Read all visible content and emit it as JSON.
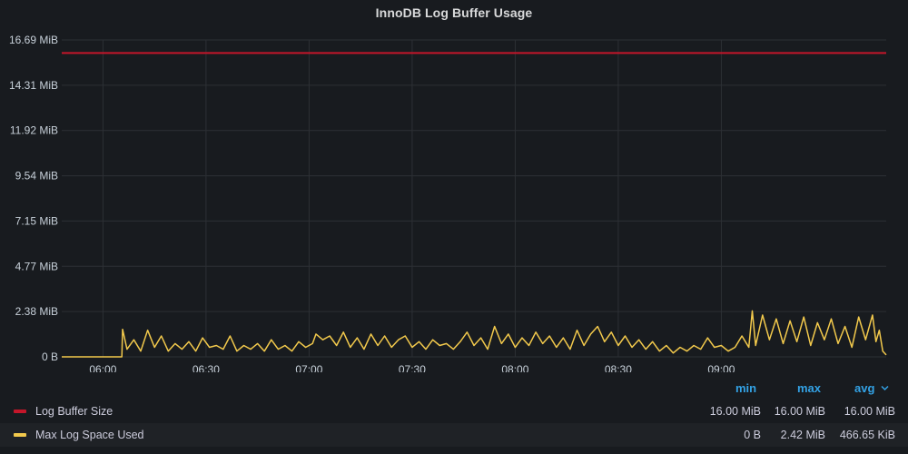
{
  "panel": {
    "title": "InnoDB Log Buffer Usage"
  },
  "colors": {
    "background": "#181b1f",
    "grid": "#2c3035",
    "series1": "#c4162a",
    "series2": "#f2c94c",
    "legend_header": "#33a2e5"
  },
  "legend": {
    "headers": {
      "min": "min",
      "max": "max",
      "avg": "avg"
    },
    "sort_icon": "chevron-down-icon",
    "rows": [
      {
        "name": "Log Buffer Size",
        "color": "#c4162a",
        "min": "16.00 MiB",
        "max": "16.00 MiB",
        "avg": "16.00 MiB"
      },
      {
        "name": "Max Log Space Used",
        "color": "#f2c94c",
        "min": "0 B",
        "max": "2.42 MiB",
        "avg": "466.65 KiB"
      }
    ]
  },
  "chart_data": {
    "type": "line",
    "title": "InnoDB Log Buffer Usage",
    "x_range": [
      "05:48",
      "09:48"
    ],
    "x_tick_labels": [
      "06:00",
      "06:30",
      "07:00",
      "07:30",
      "08:00",
      "08:30",
      "09:00"
    ],
    "y_tick_labels": [
      "0 B",
      "2.38 MiB",
      "4.77 MiB",
      "7.15 MiB",
      "9.54 MiB",
      "11.92 MiB",
      "14.31 MiB",
      "16.69 MiB"
    ],
    "y_unit": "MiB",
    "ylim": [
      0,
      16.69
    ],
    "grid": true,
    "series": [
      {
        "name": "Log Buffer Size",
        "values": [
          [
            0,
            16.0
          ],
          [
            240,
            16.0
          ]
        ]
      },
      {
        "name": "Max Log Space Used",
        "values": [
          [
            0,
            0
          ],
          [
            17.5,
            0
          ],
          [
            17.7,
            1.45
          ],
          [
            19,
            0.4
          ],
          [
            21,
            0.9
          ],
          [
            23,
            0.3
          ],
          [
            25,
            1.4
          ],
          [
            27,
            0.5
          ],
          [
            29,
            1.1
          ],
          [
            31,
            0.3
          ],
          [
            33,
            0.7
          ],
          [
            35,
            0.4
          ],
          [
            37,
            0.8
          ],
          [
            39,
            0.3
          ],
          [
            41,
            1.0
          ],
          [
            43,
            0.5
          ],
          [
            45,
            0.6
          ],
          [
            47,
            0.4
          ],
          [
            49,
            1.1
          ],
          [
            51,
            0.3
          ],
          [
            53,
            0.6
          ],
          [
            55,
            0.4
          ],
          [
            57,
            0.7
          ],
          [
            59,
            0.3
          ],
          [
            61,
            0.9
          ],
          [
            63,
            0.4
          ],
          [
            65,
            0.6
          ],
          [
            67,
            0.3
          ],
          [
            69,
            0.8
          ],
          [
            71,
            0.5
          ],
          [
            73,
            0.7
          ],
          [
            74,
            1.2
          ],
          [
            76,
            0.9
          ],
          [
            78,
            1.1
          ],
          [
            80,
            0.6
          ],
          [
            82,
            1.3
          ],
          [
            84,
            0.5
          ],
          [
            86,
            1.0
          ],
          [
            88,
            0.4
          ],
          [
            90,
            1.2
          ],
          [
            92,
            0.6
          ],
          [
            94,
            1.1
          ],
          [
            96,
            0.5
          ],
          [
            98,
            0.9
          ],
          [
            100,
            1.1
          ],
          [
            102,
            0.5
          ],
          [
            104,
            0.8
          ],
          [
            106,
            0.4
          ],
          [
            108,
            0.9
          ],
          [
            110,
            0.6
          ],
          [
            112,
            0.7
          ],
          [
            114,
            0.4
          ],
          [
            116,
            0.8
          ],
          [
            118,
            1.3
          ],
          [
            120,
            0.6
          ],
          [
            122,
            1.0
          ],
          [
            124,
            0.4
          ],
          [
            126,
            1.6
          ],
          [
            128,
            0.7
          ],
          [
            130,
            1.2
          ],
          [
            132,
            0.5
          ],
          [
            134,
            1.0
          ],
          [
            136,
            0.6
          ],
          [
            138,
            1.3
          ],
          [
            140,
            0.7
          ],
          [
            142,
            1.1
          ],
          [
            144,
            0.5
          ],
          [
            146,
            1.0
          ],
          [
            148,
            0.4
          ],
          [
            150,
            1.4
          ],
          [
            152,
            0.6
          ],
          [
            154,
            1.2
          ],
          [
            156,
            1.6
          ],
          [
            158,
            0.8
          ],
          [
            160,
            1.3
          ],
          [
            162,
            0.6
          ],
          [
            164,
            1.1
          ],
          [
            166,
            0.5
          ],
          [
            168,
            0.9
          ],
          [
            170,
            0.4
          ],
          [
            172,
            0.8
          ],
          [
            174,
            0.3
          ],
          [
            176,
            0.6
          ],
          [
            178,
            0.2
          ],
          [
            180,
            0.5
          ],
          [
            182,
            0.3
          ],
          [
            184,
            0.6
          ],
          [
            186,
            0.4
          ],
          [
            188,
            1.0
          ],
          [
            190,
            0.5
          ],
          [
            192,
            0.6
          ],
          [
            194,
            0.3
          ],
          [
            196,
            0.5
          ],
          [
            198,
            1.1
          ],
          [
            200,
            0.5
          ],
          [
            201,
            2.42
          ],
          [
            202,
            0.6
          ],
          [
            204,
            2.2
          ],
          [
            206,
            0.9
          ],
          [
            208,
            2.0
          ],
          [
            210,
            0.7
          ],
          [
            212,
            1.9
          ],
          [
            214,
            0.8
          ],
          [
            216,
            2.1
          ],
          [
            218,
            0.6
          ],
          [
            220,
            1.8
          ],
          [
            222,
            0.9
          ],
          [
            224,
            2.0
          ],
          [
            226,
            0.7
          ],
          [
            228,
            1.6
          ],
          [
            230,
            0.5
          ],
          [
            232,
            2.1
          ],
          [
            234,
            0.9
          ],
          [
            236,
            2.2
          ],
          [
            237,
            0.8
          ],
          [
            238,
            1.4
          ],
          [
            239,
            0.3
          ],
          [
            240,
            0.1
          ]
        ]
      }
    ]
  }
}
